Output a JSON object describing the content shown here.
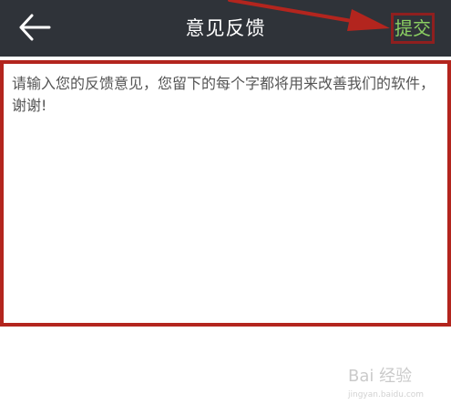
{
  "header": {
    "title": "意见反馈",
    "submit_label": "提交",
    "back_icon": "back-arrow-icon"
  },
  "feedback": {
    "placeholder": "请输入您的反馈意见，您留下的每个字都将用来改善我们的软件，谢谢!"
  },
  "watermark": {
    "logo": "Bai 经验",
    "url": "jingyan.baidu.com"
  },
  "colors": {
    "header_bg": "#2f3339",
    "submit_text": "#8bcf62",
    "annotation_red": "#b3251e"
  }
}
